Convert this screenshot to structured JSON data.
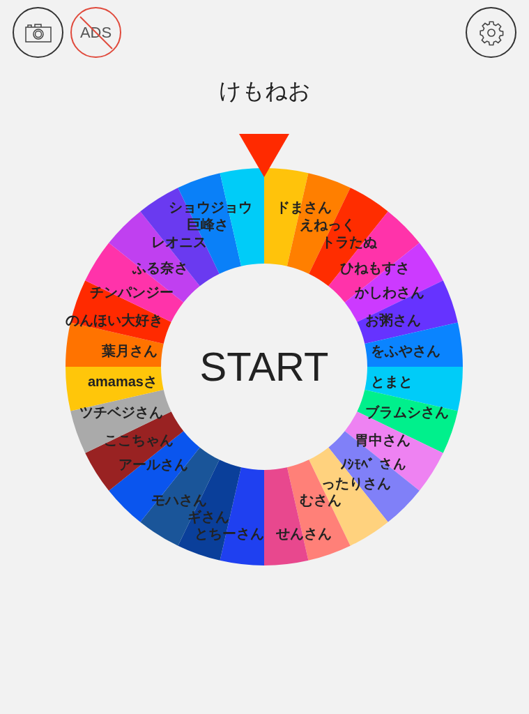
{
  "title": "けもねお",
  "toolbar": {
    "ads_label": "ADS"
  },
  "wheel": {
    "left_half": [
      {
        "label": "ショウジョウ",
        "color": "#00ccf8"
      },
      {
        "label": "巨峰さ",
        "color": "#0a80f8"
      },
      {
        "label": "レオニス",
        "color": "#6a3af0"
      },
      {
        "label": "ふる奈さ",
        "color": "#c040f0"
      },
      {
        "label": "チンパンジー",
        "color": "#ff33aa"
      },
      {
        "label": "のんほい大好き",
        "color": "#ff2a00"
      },
      {
        "label": "葉月さん",
        "color": "#ff7300"
      },
      {
        "label": "amamasさ",
        "color": "#ffc60a"
      },
      {
        "label": "ツチベジさん",
        "color": "#aaaaaa"
      },
      {
        "label": "ここちゃん",
        "color": "#992222"
      },
      {
        "label": "アールさん",
        "color": "#0a55ee"
      },
      {
        "label": "モハさん",
        "color": "#1a5599"
      },
      {
        "label": "ギさん",
        "color": "#0a3f9a"
      },
      {
        "label": "とちーさん",
        "color": "#1f40f0"
      }
    ],
    "right_half": [
      {
        "label": "ドまさん",
        "color": "#ffc30b"
      },
      {
        "label": "えねっく",
        "color": "#ff7f00"
      },
      {
        "label": "トラたぬ",
        "color": "#ff2d00"
      },
      {
        "label": "ひねもすさ",
        "color": "#ff33aa"
      },
      {
        "label": "かしわさん",
        "color": "#cc3aff"
      },
      {
        "label": "お粥さん",
        "color": "#6633ff"
      },
      {
        "label": "をふやさん",
        "color": "#0a84ff"
      },
      {
        "label": "とまと",
        "color": "#00ccf8"
      },
      {
        "label": "ブラムシさん",
        "color": "#00f08c"
      },
      {
        "label": "胃中さん",
        "color": "#ee82f2"
      },
      {
        "label": "ﾉｼﾓﾍﾞ さん",
        "color": "#8080f8"
      },
      {
        "label": "ったりさん",
        "color": "#ffd27e"
      },
      {
        "label": "むさん",
        "color": "#ff8078"
      },
      {
        "label": "せんさん",
        "color": "#e8488e"
      }
    ]
  },
  "start_button": "START"
}
